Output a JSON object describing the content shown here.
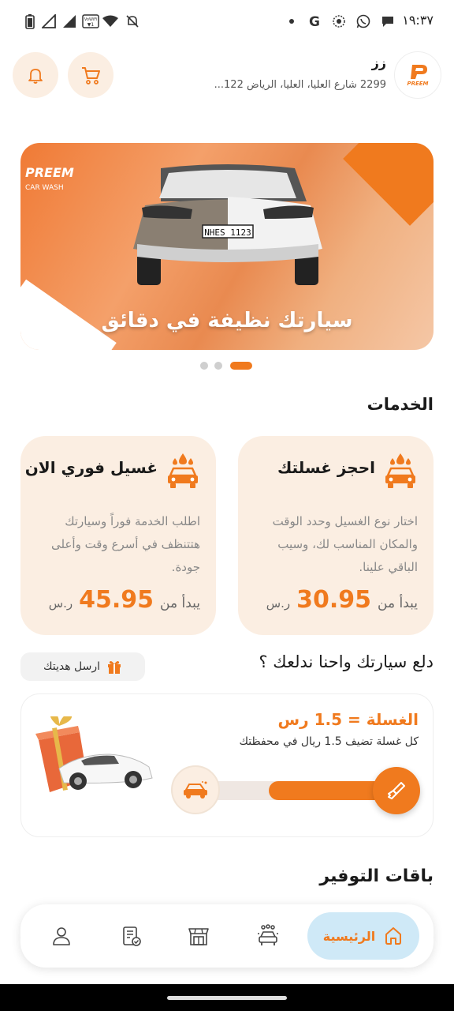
{
  "status_bar": {
    "time": "١٩:٣٧",
    "icons": [
      "battery-icon",
      "signal-icon",
      "signal-icon",
      "vowifi-icon",
      "wifi-icon",
      "mute-icon",
      "dot-icon",
      "google-icon",
      "app-icon",
      "whatsapp-icon",
      "chat-icon"
    ],
    "vowifi_label": "VoWiFi"
  },
  "header": {
    "user_name": "زز",
    "address": "2299 شارع العليا، العليا، الرياض 122...",
    "logo_text": "PREEM"
  },
  "banner": {
    "caption": "سيارتك نظيفة في دقائق",
    "brand": "PREEM",
    "brand_sub": "CAR WASH",
    "plate": "NHES 1123",
    "pager_count": 3,
    "active_index": 2
  },
  "services": {
    "title": "الخدمات",
    "cards": [
      {
        "title": "احجز غسلتك",
        "description": "اختار نوع الغسيل وحدد الوقت والمكان المناسب لك، وسيب الباقي علينا.",
        "price_prefix": "يبدأ من",
        "price": "30.95",
        "currency": "ر.س"
      },
      {
        "title": "غسيل فوري الان",
        "description": "اطلب الخدمة فوراً وسيارتك هتتنظف في أسرع وقت وأعلى جودة.",
        "price_prefix": "يبدأ من",
        "price": "45.95",
        "currency": "ر.س"
      }
    ]
  },
  "gift": {
    "title": "دلع سيارتك واحنا ندلعك ؟",
    "send_gift_label": "ارسل هديتك"
  },
  "promo": {
    "title": "الغسلة = 1.5 رس",
    "subtitle": "كل غسلة تضيف 1.5 ريال في محفظتك",
    "progress": 0.6
  },
  "savings": {
    "title": "باقات التوفير"
  },
  "bottom_nav": {
    "items": [
      {
        "id": "home",
        "label": "الرئيسية",
        "icon": "home-icon",
        "active": true
      },
      {
        "id": "services",
        "icon": "car-wash-icon"
      },
      {
        "id": "store",
        "icon": "store-icon"
      },
      {
        "id": "orders",
        "icon": "orders-icon"
      },
      {
        "id": "profile",
        "icon": "user-icon"
      }
    ]
  },
  "colors": {
    "accent": "#f07a1e",
    "card_bg": "#fbeee2",
    "nav_active_bg": "#cfe9f7"
  }
}
